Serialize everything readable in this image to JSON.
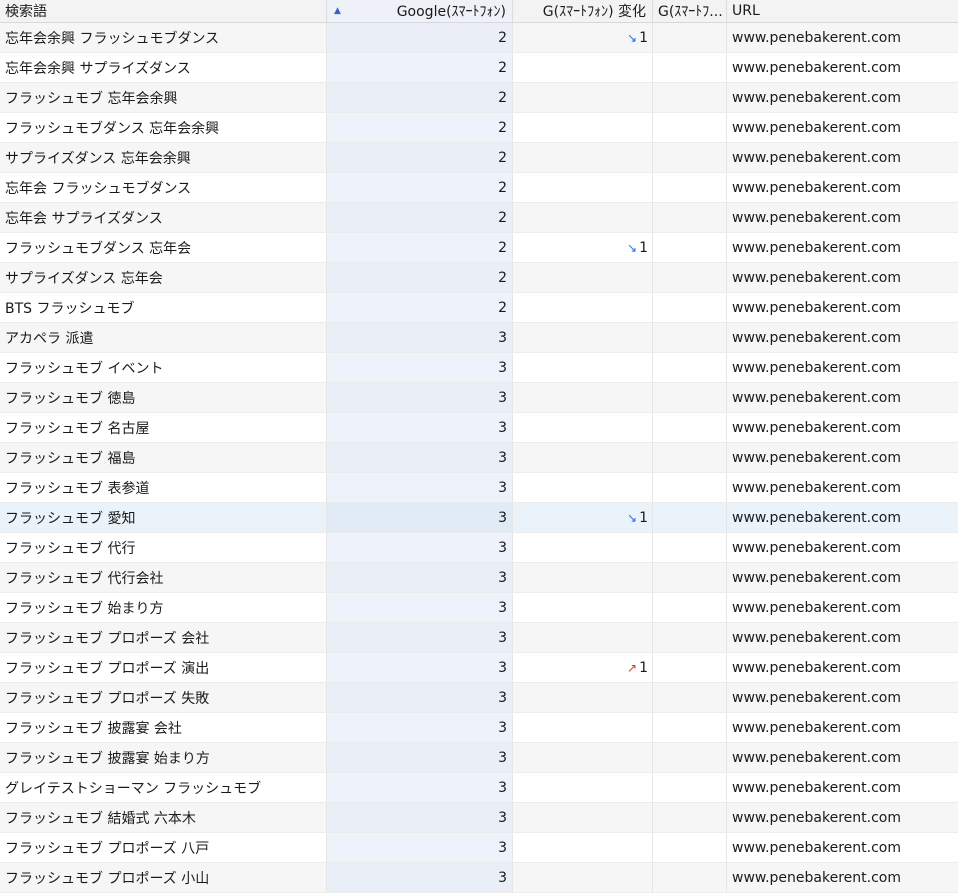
{
  "headers": {
    "keyword": "検索語",
    "google_sp": "Google(ｽﾏｰﾄﾌｫﾝ)",
    "change": "G(ｽﾏｰﾄﾌｫﾝ) 変化",
    "prev": "G(ｽﾏｰﾄﾌ...",
    "url": "URL"
  },
  "rows": [
    {
      "keyword": "忘年会余興 フラッシュモブダンス",
      "rank": "2",
      "change_dir": "down",
      "change": "1",
      "url": "www.penebakerent.com"
    },
    {
      "keyword": "忘年会余興 サプライズダンス",
      "rank": "2",
      "change_dir": "",
      "change": "",
      "url": "www.penebakerent.com"
    },
    {
      "keyword": "フラッシュモブ 忘年会余興",
      "rank": "2",
      "change_dir": "",
      "change": "",
      "url": "www.penebakerent.com"
    },
    {
      "keyword": "フラッシュモブダンス 忘年会余興",
      "rank": "2",
      "change_dir": "",
      "change": "",
      "url": "www.penebakerent.com"
    },
    {
      "keyword": "サプライズダンス 忘年会余興",
      "rank": "2",
      "change_dir": "",
      "change": "",
      "url": "www.penebakerent.com"
    },
    {
      "keyword": "忘年会 フラッシュモブダンス",
      "rank": "2",
      "change_dir": "",
      "change": "",
      "url": "www.penebakerent.com"
    },
    {
      "keyword": "忘年会 サプライズダンス",
      "rank": "2",
      "change_dir": "",
      "change": "",
      "url": "www.penebakerent.com"
    },
    {
      "keyword": "フラッシュモブダンス 忘年会",
      "rank": "2",
      "change_dir": "down",
      "change": "1",
      "url": "www.penebakerent.com"
    },
    {
      "keyword": "サプライズダンス 忘年会",
      "rank": "2",
      "change_dir": "",
      "change": "",
      "url": "www.penebakerent.com"
    },
    {
      "keyword": "BTS フラッシュモブ",
      "rank": "2",
      "change_dir": "",
      "change": "",
      "url": "www.penebakerent.com"
    },
    {
      "keyword": "アカペラ 派遣",
      "rank": "3",
      "change_dir": "",
      "change": "",
      "url": "www.penebakerent.com"
    },
    {
      "keyword": "フラッシュモブ イベント",
      "rank": "3",
      "change_dir": "",
      "change": "",
      "url": "www.penebakerent.com"
    },
    {
      "keyword": "フラッシュモブ 徳島",
      "rank": "3",
      "change_dir": "",
      "change": "",
      "url": "www.penebakerent.com"
    },
    {
      "keyword": "フラッシュモブ 名古屋",
      "rank": "3",
      "change_dir": "",
      "change": "",
      "url": "www.penebakerent.com"
    },
    {
      "keyword": "フラッシュモブ 福島",
      "rank": "3",
      "change_dir": "",
      "change": "",
      "url": "www.penebakerent.com"
    },
    {
      "keyword": "フラッシュモブ 表参道",
      "rank": "3",
      "change_dir": "",
      "change": "",
      "url": "www.penebakerent.com"
    },
    {
      "keyword": "フラッシュモブ 愛知",
      "rank": "3",
      "change_dir": "down",
      "change": "1",
      "url": "www.penebakerent.com",
      "selected": true
    },
    {
      "keyword": "フラッシュモブ 代行",
      "rank": "3",
      "change_dir": "",
      "change": "",
      "url": "www.penebakerent.com"
    },
    {
      "keyword": "フラッシュモブ 代行会社",
      "rank": "3",
      "change_dir": "",
      "change": "",
      "url": "www.penebakerent.com"
    },
    {
      "keyword": "フラッシュモブ 始まり方",
      "rank": "3",
      "change_dir": "",
      "change": "",
      "url": "www.penebakerent.com"
    },
    {
      "keyword": "フラッシュモブ プロポーズ 会社",
      "rank": "3",
      "change_dir": "",
      "change": "",
      "url": "www.penebakerent.com"
    },
    {
      "keyword": "フラッシュモブ プロポーズ 演出",
      "rank": "3",
      "change_dir": "up",
      "change": "1",
      "url": "www.penebakerent.com"
    },
    {
      "keyword": "フラッシュモブ プロポーズ 失敗",
      "rank": "3",
      "change_dir": "",
      "change": "",
      "url": "www.penebakerent.com"
    },
    {
      "keyword": "フラッシュモブ 披露宴 会社",
      "rank": "3",
      "change_dir": "",
      "change": "",
      "url": "www.penebakerent.com"
    },
    {
      "keyword": "フラッシュモブ 披露宴 始まり方",
      "rank": "3",
      "change_dir": "",
      "change": "",
      "url": "www.penebakerent.com"
    },
    {
      "keyword": "グレイテストショーマン フラッシュモブ",
      "rank": "3",
      "change_dir": "",
      "change": "",
      "url": "www.penebakerent.com"
    },
    {
      "keyword": "フラッシュモブ 結婚式 六本木",
      "rank": "3",
      "change_dir": "",
      "change": "",
      "url": "www.penebakerent.com"
    },
    {
      "keyword": "フラッシュモブ プロポーズ 八戸",
      "rank": "3",
      "change_dir": "",
      "change": "",
      "url": "www.penebakerent.com"
    },
    {
      "keyword": "フラッシュモブ プロポーズ 小山",
      "rank": "3",
      "change_dir": "",
      "change": "",
      "url": "www.penebakerent.com"
    }
  ],
  "icons": {
    "sort": "sort-ascending-icon",
    "down": "trend-down-arrow-icon",
    "up": "trend-up-arrow-icon"
  },
  "colors": {
    "down_arrow": "#2a6ad6",
    "up_arrow": "#d43a2a",
    "sort_icon": "#3a64c8",
    "selected_row": "#eaf3f9"
  }
}
